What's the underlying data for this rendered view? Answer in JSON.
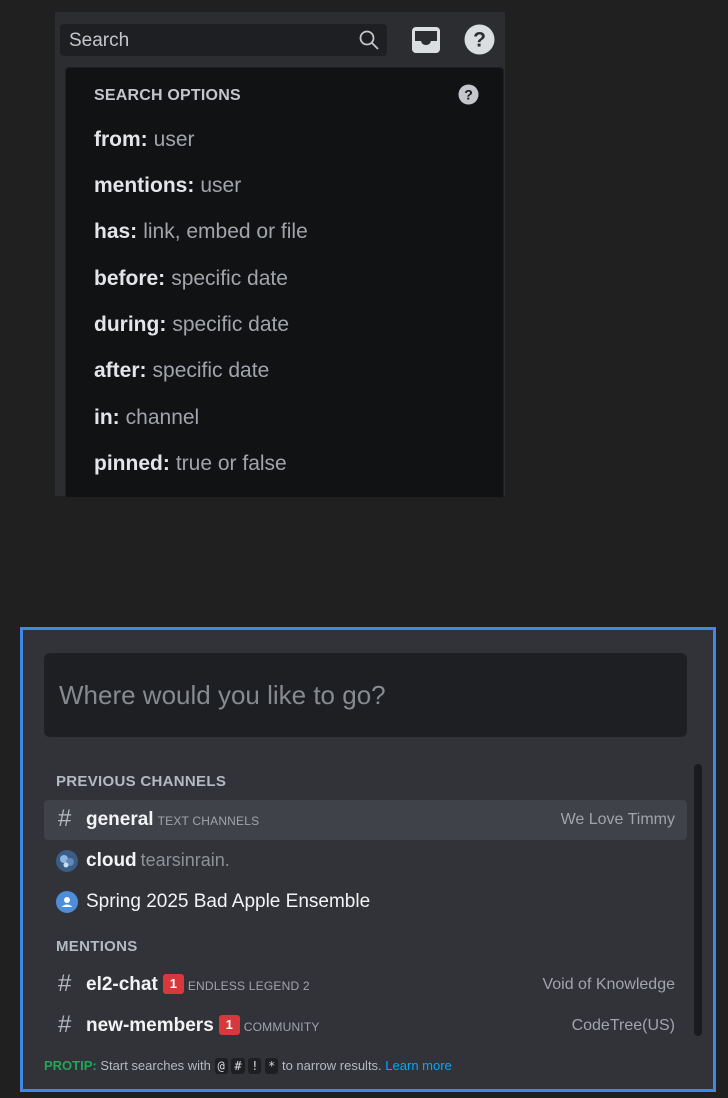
{
  "search": {
    "placeholder": "Search",
    "options_header": "SEARCH OPTIONS",
    "options": [
      {
        "key": "from:",
        "hint": "user"
      },
      {
        "key": "mentions:",
        "hint": "user"
      },
      {
        "key": "has:",
        "hint": "link, embed or file"
      },
      {
        "key": "before:",
        "hint": "specific date"
      },
      {
        "key": "during:",
        "hint": "specific date"
      },
      {
        "key": "after:",
        "hint": "specific date"
      },
      {
        "key": "in:",
        "hint": "channel"
      },
      {
        "key": "pinned:",
        "hint": "true or false"
      }
    ]
  },
  "switcher": {
    "placeholder": "Where would you like to go?",
    "previous_label": "PREVIOUS CHANNELS",
    "mentions_label": "MENTIONS",
    "previous": [
      {
        "name": "general",
        "sub": "TEXT CHANNELS",
        "server": "We Love Timmy",
        "icon": "hash-icon"
      },
      {
        "name": "cloud",
        "sub": "tearsinrain.",
        "icon": "user-avatar"
      },
      {
        "name": "Spring 2025 Bad Apple Ensemble",
        "icon": "group-dm-icon"
      }
    ],
    "mentions": [
      {
        "name": "el2-chat",
        "badge": "1",
        "sub": "ENDLESS LEGEND 2",
        "server": "Void of Knowledge",
        "icon": "hash-icon"
      },
      {
        "name": "new-members",
        "badge": "1",
        "sub": "COMMUNITY",
        "server": "CodeTree(US)",
        "icon": "hash-icon"
      }
    ],
    "protip": {
      "label": "PROTIP:",
      "text_before": "Start searches with",
      "symbols": [
        "@",
        "#",
        "!",
        "*"
      ],
      "text_after": "to narrow results.",
      "link": "Learn more"
    }
  }
}
